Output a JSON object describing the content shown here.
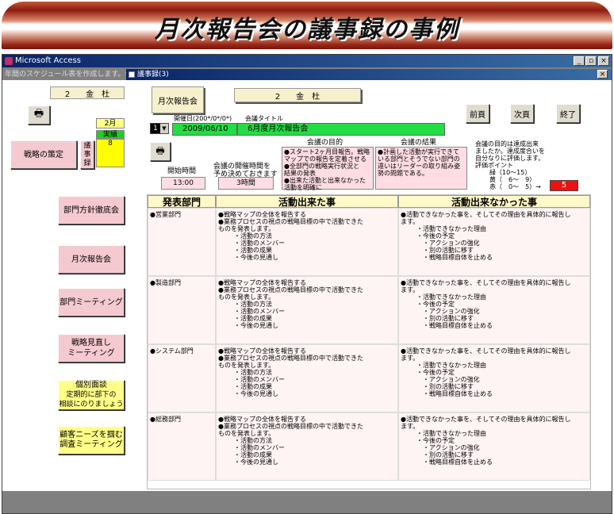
{
  "banner": {
    "title": "月次報告会の議事録の事例"
  },
  "window": {
    "title": "Microsoft Access"
  },
  "left_panel": {
    "title": "年間のスケジュール表を作成します。会議",
    "company": "2　　金　杜",
    "month": "2月",
    "status_label": "実績",
    "status_value": "8",
    "buttons": {
      "strategy": "戦略の策定",
      "minutes": "議事録",
      "dept_policy": "部門方針徹底会",
      "monthly": "月次報告会",
      "dept_meeting": "部門ミーティング",
      "review_1": "戦略見直し",
      "review_2": "ミーティング",
      "interview_1": "個別面談",
      "interview_2": "定期的に部下の",
      "interview_3": "相談にのりましょう",
      "customer_1": "顧客ニーズを掴む",
      "customer_2": "調査ミーティング"
    }
  },
  "form": {
    "title": "議事録(3)",
    "meeting_type": "月次報告会",
    "company": "2　　金　杜",
    "date_label": "開催日(200*/0*/0*)",
    "title_label": "会議タイトル",
    "record_no": "1",
    "date_value": "2009/06/10",
    "title_value": "6月度月次報告会",
    "nav": {
      "prev": "前頁",
      "next": "次頁",
      "end": "終了"
    },
    "start_label": "開始時間",
    "start_value": "13:00",
    "duration_label_1": "会議の開催時間を",
    "duration_label_2": "予め決めておきます",
    "duration_value": "3時間",
    "purpose_label": "会議の目的",
    "purpose_lines": [
      "●スタート2ヶ月目報告。戦略",
      "マップでの報告を定着させる",
      "●全部門の戦略実行状況と",
      "結果の発表",
      "●出来た活動と出来なかった",
      "活動を明確に"
    ],
    "result_label": "会議の結果",
    "result_lines": [
      "●計画した活動が実行できて",
      "いる部門とそうでない部門の",
      "違いはリーダーの取り組み姿",
      "勢の問題である。"
    ],
    "eval_lines": [
      "会議の目的は達成出来",
      "ましたか。達成度合いを",
      "自分なりに評価します。",
      "評価ポイント"
    ],
    "eval_green": "緑（10～15）",
    "eval_yellow": "黄（　6～　9）",
    "eval_red": "赤（　0～　5）→",
    "eval_score": "5"
  },
  "table": {
    "headers": [
      "発表部門",
      "活動出来た事",
      "活動出来なかった事"
    ],
    "rows": [
      {
        "dept": "●営業部門"
      },
      {
        "dept": "●製造部門"
      },
      {
        "dept": "●システム部門"
      },
      {
        "dept": "●総務部門"
      }
    ],
    "done": {
      "l1": "●戦略マップの全体を報告する",
      "l2": "●業務プロセスの視点の戦略目標の中で活動できた",
      "l3": "ものを発表します。",
      "items": [
        "・活動の方法",
        "・活動のメンバー",
        "・活動の成果",
        "・今後の見通し"
      ]
    },
    "notdone": {
      "l1": "●活動できなかった事を、そしてその理由を具体的に報告し",
      "l2": "ます。",
      "l3": "・活動できなかった理由",
      "l4": "・今後の予定",
      "items": [
        "・アクションの強化",
        "・別の活動に移す",
        "・戦略目標自体を止める"
      ]
    }
  }
}
